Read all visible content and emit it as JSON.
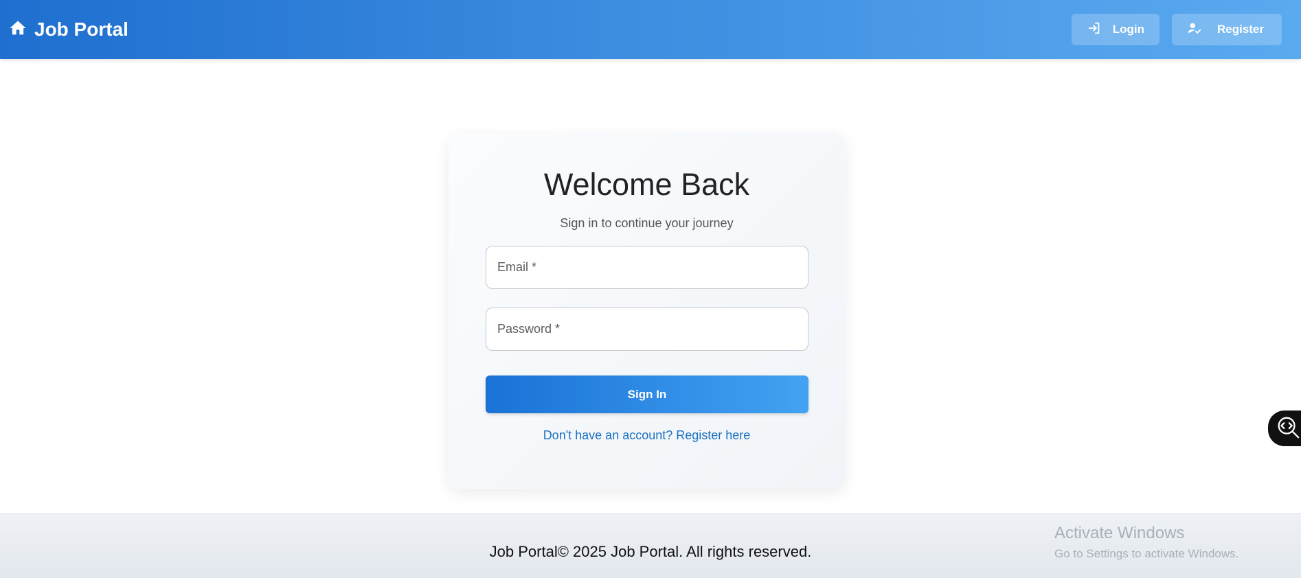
{
  "header": {
    "brand_icon": "home-icon",
    "brand_title": "Job Portal",
    "login_label": "Login",
    "login_icon": "login-icon",
    "register_label": "Register",
    "register_icon": "user-check-icon"
  },
  "card": {
    "title": "Welcome Back",
    "subtitle": "Sign in to continue your journey",
    "email_placeholder": "Email *",
    "password_placeholder": "Password *",
    "signin_label": "Sign In",
    "register_link": "Don't have an account? Register here"
  },
  "footer": {
    "text": "Job Portal© 2025 Job Portal. All rights reserved."
  },
  "watermark": {
    "title": "Activate Windows",
    "subtitle": "Go to Settings to activate Windows."
  },
  "widget": {
    "icon": "code-search-icon"
  },
  "colors": {
    "header_start": "#1e6fcf",
    "header_end": "#5aaaf0",
    "button_start": "#1a72d6",
    "button_end": "#43a2f2",
    "link": "#1a6fc2"
  }
}
